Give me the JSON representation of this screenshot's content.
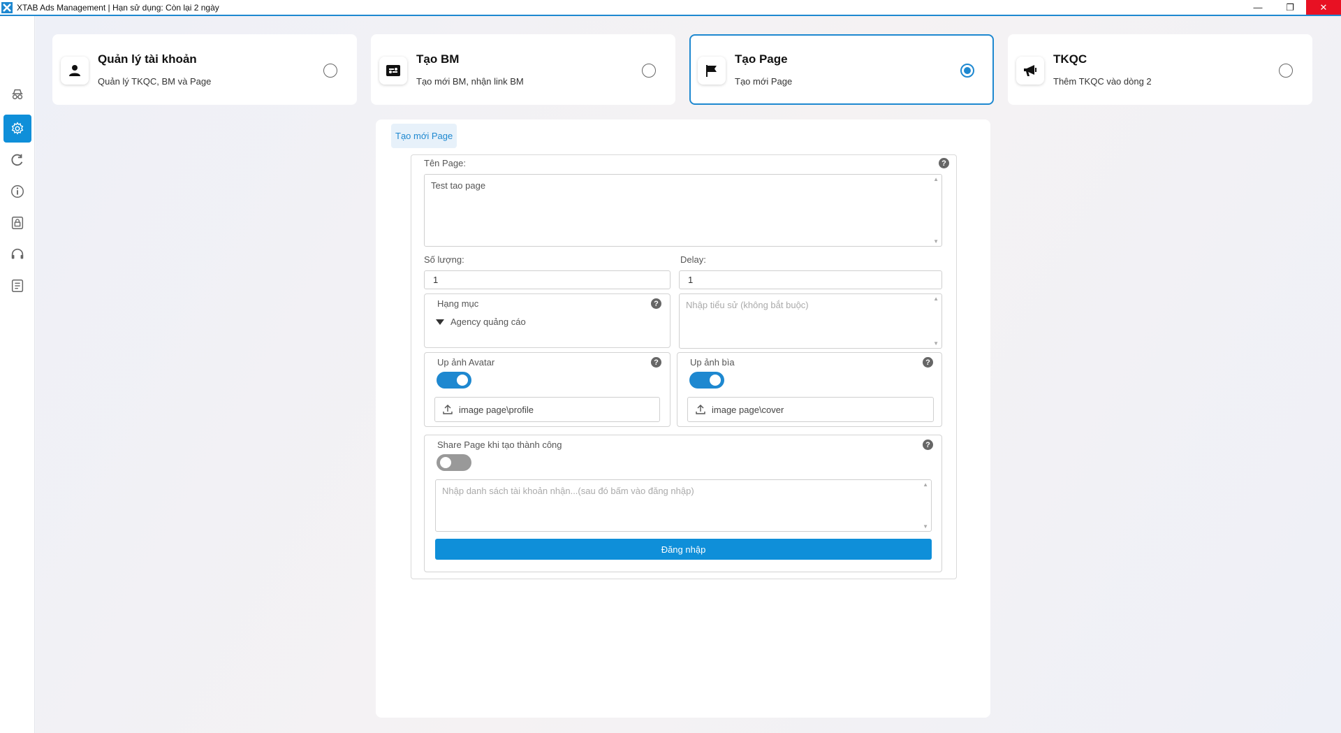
{
  "window": {
    "title": "XTAB Ads Management | Hạn sử dụng: Còn lại 2 ngày",
    "minimize": "—",
    "restore": "❐",
    "close": "✕"
  },
  "sidebar": {
    "items": [
      {
        "name": "incognito-icon",
        "active": false
      },
      {
        "name": "settings-icon",
        "active": true
      },
      {
        "name": "refresh-icon",
        "active": false
      },
      {
        "name": "info-icon",
        "active": false
      },
      {
        "name": "lock-icon",
        "active": false
      },
      {
        "name": "headset-icon",
        "active": false
      },
      {
        "name": "document-icon",
        "active": false
      }
    ]
  },
  "cards": [
    {
      "title": "Quản lý tài khoản",
      "subtitle": "Quản lý TKQC, BM và Page",
      "icon": "user-icon",
      "selected": false
    },
    {
      "title": "Tạo BM",
      "subtitle": "Tạo mới BM, nhận link BM",
      "icon": "bm-icon",
      "selected": false
    },
    {
      "title": "Tạo Page",
      "subtitle": "Tạo mới Page",
      "icon": "flag-icon",
      "selected": true
    },
    {
      "title": "TKQC",
      "subtitle": "Thêm TKQC vào dòng 2",
      "icon": "megaphone-icon",
      "selected": false
    }
  ],
  "panel": {
    "tab_label": "Tạo mới Page",
    "page_name": {
      "label": "Tên Page:",
      "value": "Test tao page"
    },
    "quantity": {
      "label": "Số lượng:",
      "value": "1"
    },
    "delay": {
      "label": "Delay:",
      "value": "1"
    },
    "category": {
      "label": "Hạng mục",
      "value": "Agency quảng cáo"
    },
    "bio": {
      "placeholder": "Nhập tiểu sử (không bắt buộc)"
    },
    "avatar": {
      "label": "Up ảnh Avatar",
      "toggle": true,
      "path": "image page\\profile"
    },
    "cover": {
      "label": "Up ảnh bìa",
      "toggle": true,
      "path": "image page\\cover"
    },
    "share": {
      "label": "Share Page khi tạo thành công",
      "toggle": false,
      "placeholder": "Nhập danh sách tài khoản nhận...(sau đó bấm vào đăng nhập)",
      "button": "Đăng nhập"
    },
    "help_glyph": "?"
  },
  "colors": {
    "accent": "#1e88d0",
    "close": "#e81123"
  }
}
